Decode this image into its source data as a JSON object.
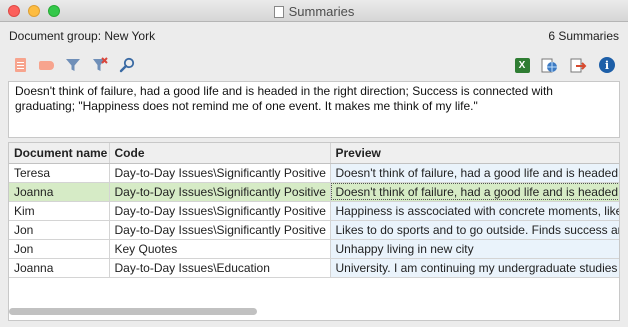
{
  "window": {
    "title": "Summaries"
  },
  "header": {
    "document_group": "Document group: New York",
    "summary_count": "6 Summaries"
  },
  "toolbar": {
    "left_icons": [
      "document-icon",
      "tag-icon",
      "filter-icon",
      "clear-filter-icon",
      "search-icon"
    ],
    "right_icons": [
      "excel-export-icon",
      "web-export-icon",
      "export-icon",
      "info-icon"
    ]
  },
  "preview": {
    "text": "Doesn't think of failure, had a good life and is headed in the right direction; Success is connected with graduating; \"Happiness does not remind me of one event. It makes me think of my life.\""
  },
  "table": {
    "columns": [
      "Document name",
      "Code",
      "Preview"
    ],
    "selected_row": 1,
    "rows": [
      [
        "Teresa",
        "Day-to-Day Issues\\Significantly Positive",
        "Doesn't think of failure, had a good life and is headed"
      ],
      [
        "Joanna",
        "Day-to-Day Issues\\Significantly Positive",
        "Doesn't think of failure, had a good life and is headed"
      ],
      [
        "Kim",
        "Day-to-Day Issues\\Significantly Positive",
        "Happiness is asscociated with concrete moments, like"
      ],
      [
        "Jon",
        "Day-to-Day Issues\\Significantly Positive",
        "Likes to do sports and to go outside. Finds success an"
      ],
      [
        "Jon",
        "Key Quotes",
        "Unhappy living in new city"
      ],
      [
        "Joanna",
        "Day-to-Day Issues\\Education",
        "University.  I am continuing my undergraduate studies"
      ]
    ]
  },
  "colors": {
    "selection": "#d6ebc6",
    "preview_column": "#eaf3fb",
    "accent_icon": "#f7a48e"
  }
}
